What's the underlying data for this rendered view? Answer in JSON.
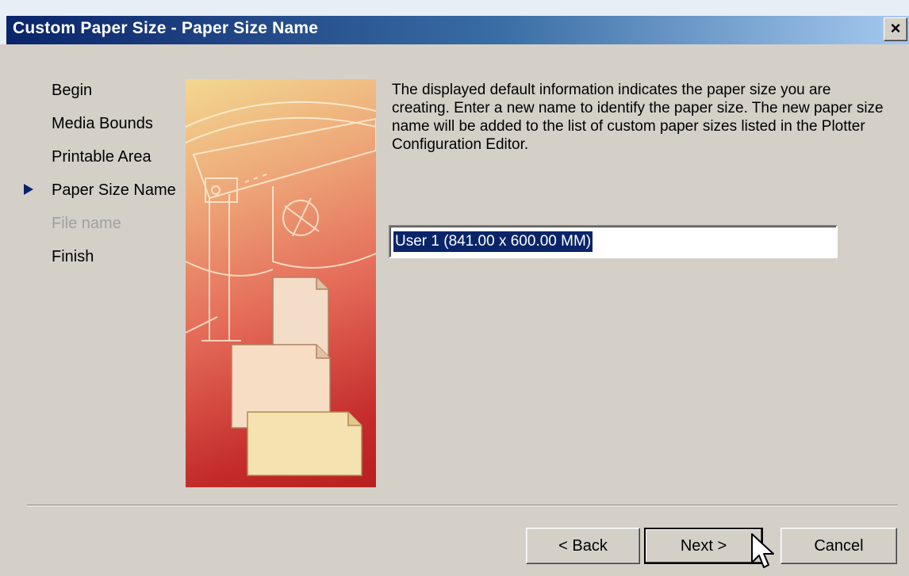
{
  "window": {
    "title": "Custom Paper Size - Paper Size Name",
    "close_label": "×"
  },
  "steps": [
    {
      "label": "Begin",
      "state": "done"
    },
    {
      "label": "Media Bounds",
      "state": "done"
    },
    {
      "label": "Printable Area",
      "state": "done"
    },
    {
      "label": "Paper Size Name",
      "state": "current"
    },
    {
      "label": "File name",
      "state": "disabled"
    },
    {
      "label": "Finish",
      "state": "pending"
    }
  ],
  "content": {
    "description": "The displayed default information indicates the paper size you are creating. Enter a new name to identify the paper size. The new paper size name will be added to the list of custom paper sizes listed in the Plotter Configuration Editor.",
    "paper_name_value": "User 1 (841.00 x 600.00 MM)"
  },
  "buttons": {
    "back": "< Back",
    "next": "Next >",
    "cancel": "Cancel"
  },
  "colors": {
    "title_bar": "#0a246a",
    "selection": "#0a246a",
    "dialog_bg": "#d4d0c8"
  }
}
